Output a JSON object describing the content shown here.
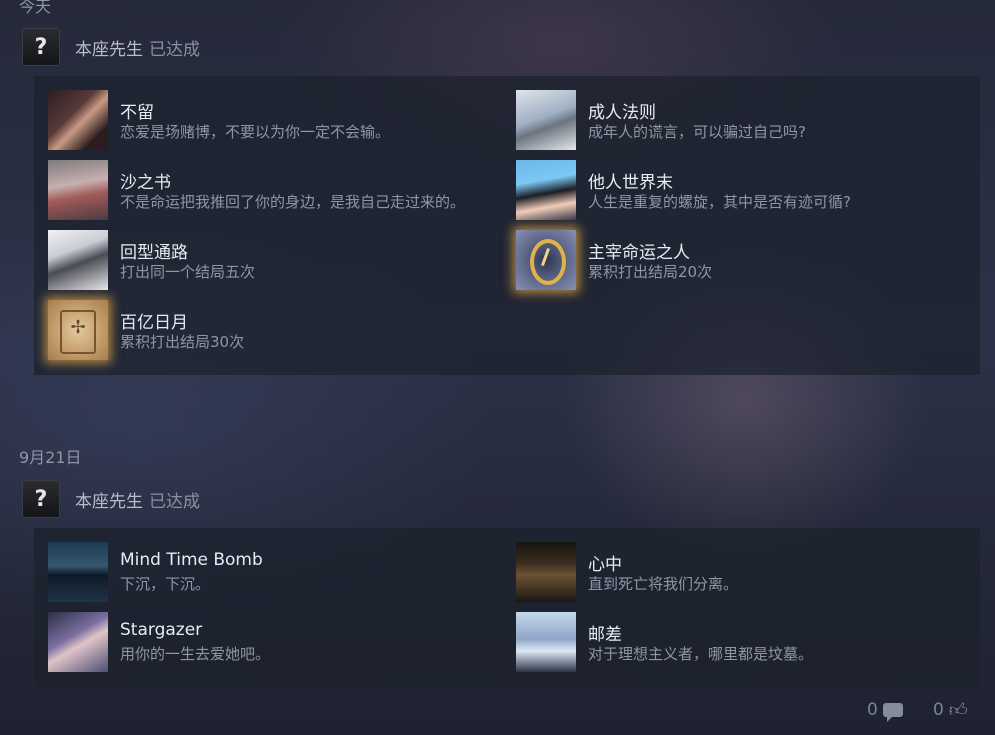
{
  "groups": [
    {
      "date": "今天",
      "owner": {
        "name": "本座先生",
        "action": "已达成",
        "avatar_glyph": "?"
      },
      "achievements": [
        {
          "title": "不留",
          "desc": "恋爱是场赌博，不要以为你一定不会输。",
          "icon": "couple-art-icon"
        },
        {
          "title": "成人法则",
          "desc": "成年人的谎言，可以骗过自己吗?",
          "icon": "rule-art-icon"
        },
        {
          "title": "沙之书",
          "desc": "不是命运把我推回了你的身边，是我自己走过来的。",
          "icon": "umbrella-girl-art-icon"
        },
        {
          "title": "他人世界末",
          "desc": "人生是重复的螺旋，其中是否有迹可循?",
          "icon": "dark-hair-girl-art-icon"
        },
        {
          "title": "回型通路",
          "desc": "打出同一个结局五次",
          "icon": "loop-art-icon"
        },
        {
          "title": "主宰命运之人",
          "desc": "累积打出结局20次",
          "icon": "golden-clock-icon"
        },
        {
          "title": "百亿日月",
          "desc": "累积打出结局30次",
          "icon": "golden-tile-icon"
        }
      ]
    },
    {
      "date": "9月21日",
      "owner": {
        "name": "本座先生",
        "action": "已达成",
        "avatar_glyph": "?"
      },
      "achievements": [
        {
          "title": "Mind Time Bomb",
          "desc": "下沉，下沉。",
          "icon": "lake-night-art-icon"
        },
        {
          "title": "心中",
          "desc": "直到死亡将我们分离。",
          "icon": "room-art-icon"
        },
        {
          "title": "Stargazer",
          "desc": "用你的一生去爱她吧。",
          "icon": "stargazer-art-icon"
        },
        {
          "title": "邮差",
          "desc": "对于理想主义者，哪里都是坟墓。",
          "icon": "night-street-art-icon"
        }
      ]
    }
  ],
  "feedback": {
    "comments": "0",
    "likes": "0"
  },
  "colors": {
    "glow": "#e6aa46",
    "title": "#e8ebf0",
    "desc": "#8f96a3"
  }
}
